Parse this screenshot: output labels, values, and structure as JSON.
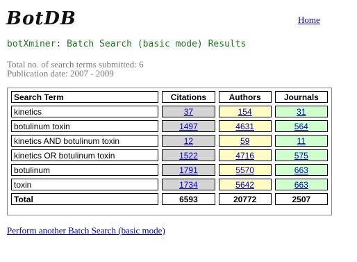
{
  "header": {
    "logo_text": "BotDB",
    "home_link": "Home"
  },
  "page_title": "botXminer: Batch Search (basic mode) Results",
  "summary": {
    "terms_submitted": "Total no. of search terms submitted: 6",
    "publication_date": "Publication date: 2007 - 2009"
  },
  "results_table": {
    "headers": [
      "Search Term",
      "Citations",
      "Authors",
      "Journals"
    ],
    "rows": [
      {
        "term": "kinetics",
        "citations": "37",
        "authors": "154",
        "journals": "31"
      },
      {
        "term": "botulinum toxin",
        "citations": "1497",
        "authors": "4631",
        "journals": "564"
      },
      {
        "term": "kinetics AND botulinum toxin",
        "citations": "12",
        "authors": "59",
        "journals": "11"
      },
      {
        "term": "kinetics OR botulinum toxin",
        "citations": "1522",
        "authors": "4716",
        "journals": "575"
      },
      {
        "term": "botulinum",
        "citations": "1791",
        "authors": "5570",
        "journals": "663"
      },
      {
        "term": "toxin",
        "citations": "1734",
        "authors": "5642",
        "journals": "663"
      }
    ],
    "total": {
      "label": "Total",
      "citations": "6593",
      "authors": "20772",
      "journals": "2507"
    }
  },
  "footer_link": "Perform another Batch Search (basic mode)",
  "colors": {
    "citations_cell": "#d4d4d4",
    "authors_cell": "#fffcc4",
    "journals_cell": "#cfffcf",
    "title_green": "#1a7a1a",
    "link_blue": "#0000cc"
  }
}
